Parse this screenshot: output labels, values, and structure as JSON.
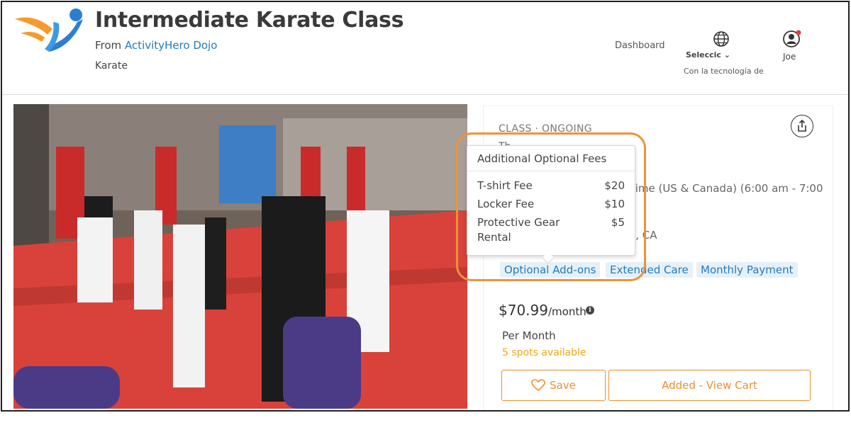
{
  "header": {
    "title": "Intermediate Karate Class",
    "from_prefix": "From ",
    "provider": "ActivityHero Dojo",
    "category": "Karate"
  },
  "nav": {
    "dashboard": "Dashboard",
    "language_select": "Seleccic",
    "language_powered": "Con la tecnología de",
    "user_name": "Joe"
  },
  "details": {
    "status": "CLASS · ONGOING",
    "partial_line": "Th...",
    "time_line_1": "Time (US & Canada) (6:00 am - 7:00",
    "time_line_2": ")",
    "location": "e, CA",
    "tags": [
      "Optional Add-ons",
      "Extended Care",
      "Monthly Payment"
    ],
    "price": "$70.99",
    "price_unit": "/month",
    "billing": "Per Month",
    "availability": "5 spots available"
  },
  "tooltip": {
    "title": "Additional Optional Fees",
    "fees": [
      {
        "name": "T-shirt Fee",
        "price": "$20"
      },
      {
        "name": "Locker Fee",
        "price": "$10"
      },
      {
        "name": "Protective Gear Rental",
        "price": "$5"
      }
    ]
  },
  "actions": {
    "save": "Save",
    "cart": "Added - View Cart"
  },
  "colors": {
    "accent": "#ef8d2c",
    "link": "#1e7bc4",
    "tag_bg": "#e6f0f9",
    "availability": "#f0a818",
    "highlight": "#f0913a"
  }
}
